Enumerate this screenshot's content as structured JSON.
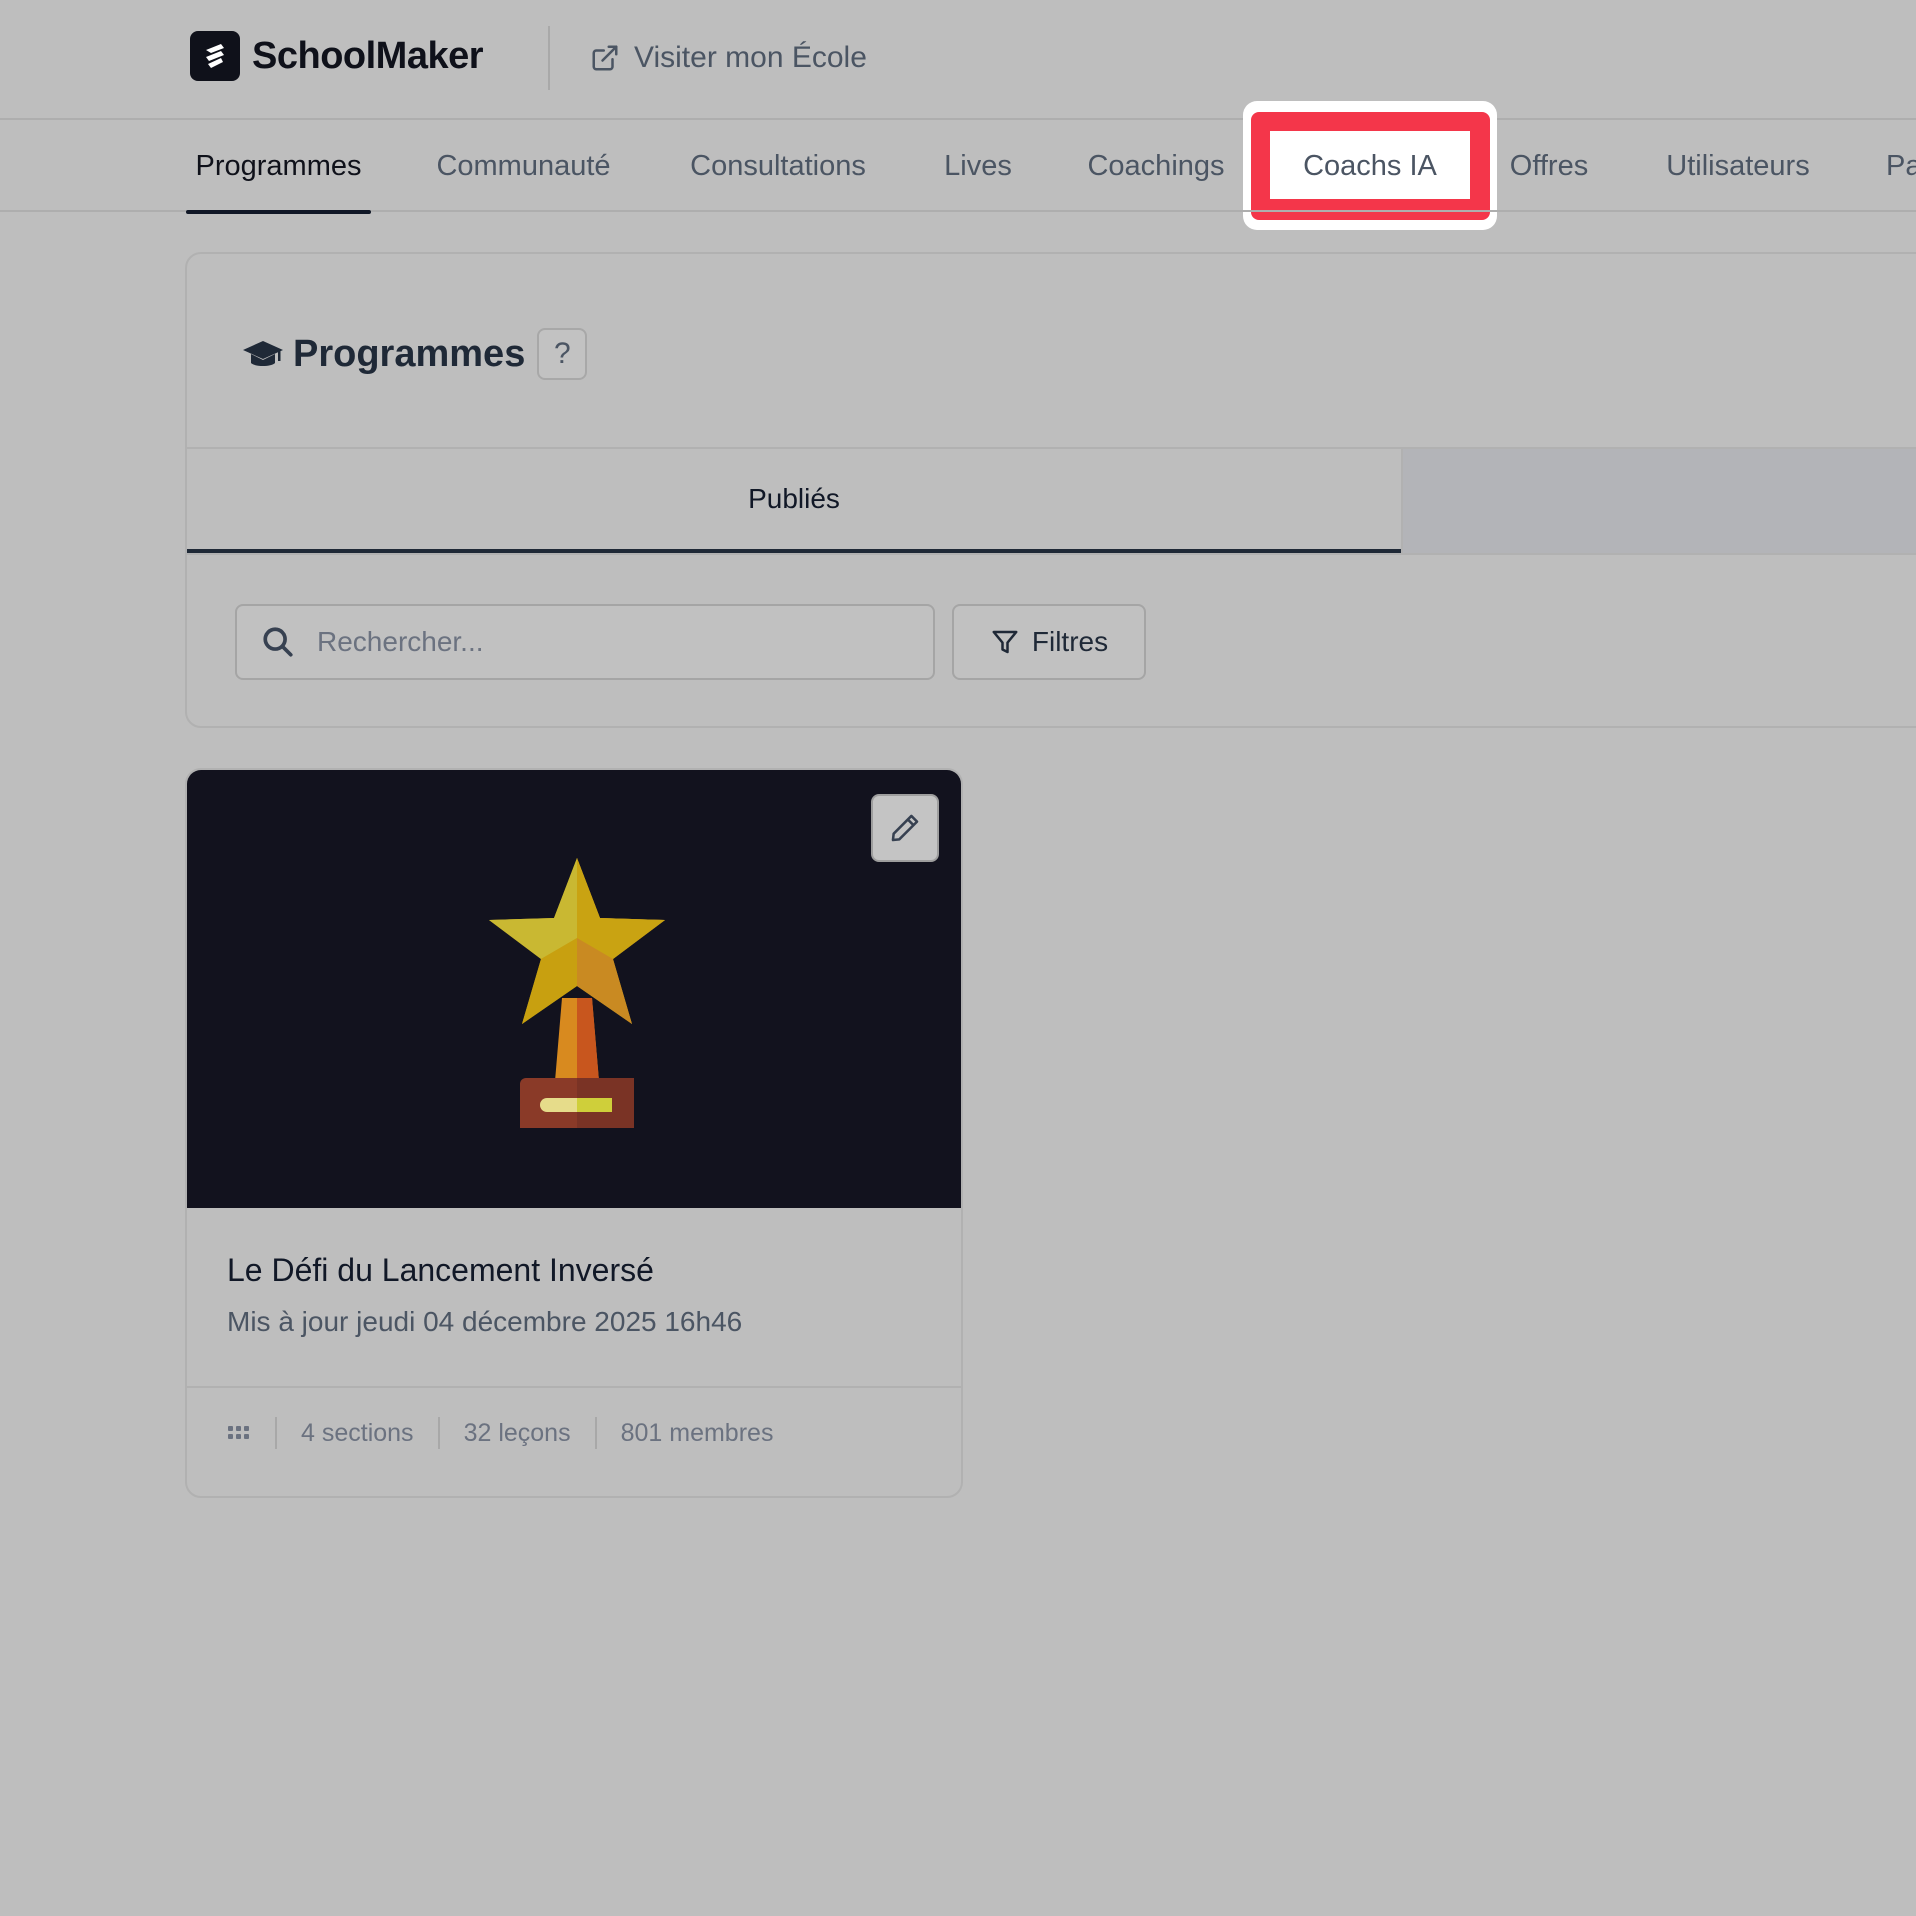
{
  "header": {
    "brand_name": "SchoolMaker",
    "visit_link": "Visiter mon École"
  },
  "nav": {
    "items": [
      {
        "label": "Programmes",
        "active": true
      },
      {
        "label": "Communauté"
      },
      {
        "label": "Consultations"
      },
      {
        "label": "Lives"
      },
      {
        "label": "Coachings"
      },
      {
        "label": "Coachs IA",
        "highlighted": true
      },
      {
        "label": "Offres"
      },
      {
        "label": "Utilisateurs"
      },
      {
        "label": "Pa"
      }
    ],
    "highlight_color": "#f4364a"
  },
  "panel": {
    "title": "Programmes",
    "help": "?",
    "tabs": [
      {
        "label": "Publiés",
        "active": true
      }
    ],
    "search_placeholder": "Rechercher...",
    "filter_label": "Filtres"
  },
  "card": {
    "title": "Le Défi du Lancement Inversé",
    "updated": "Mis à jour jeudi 04 décembre 2025 16h46",
    "sections": "4 sections",
    "lessons": "32 leçons",
    "members": "801 membres"
  }
}
